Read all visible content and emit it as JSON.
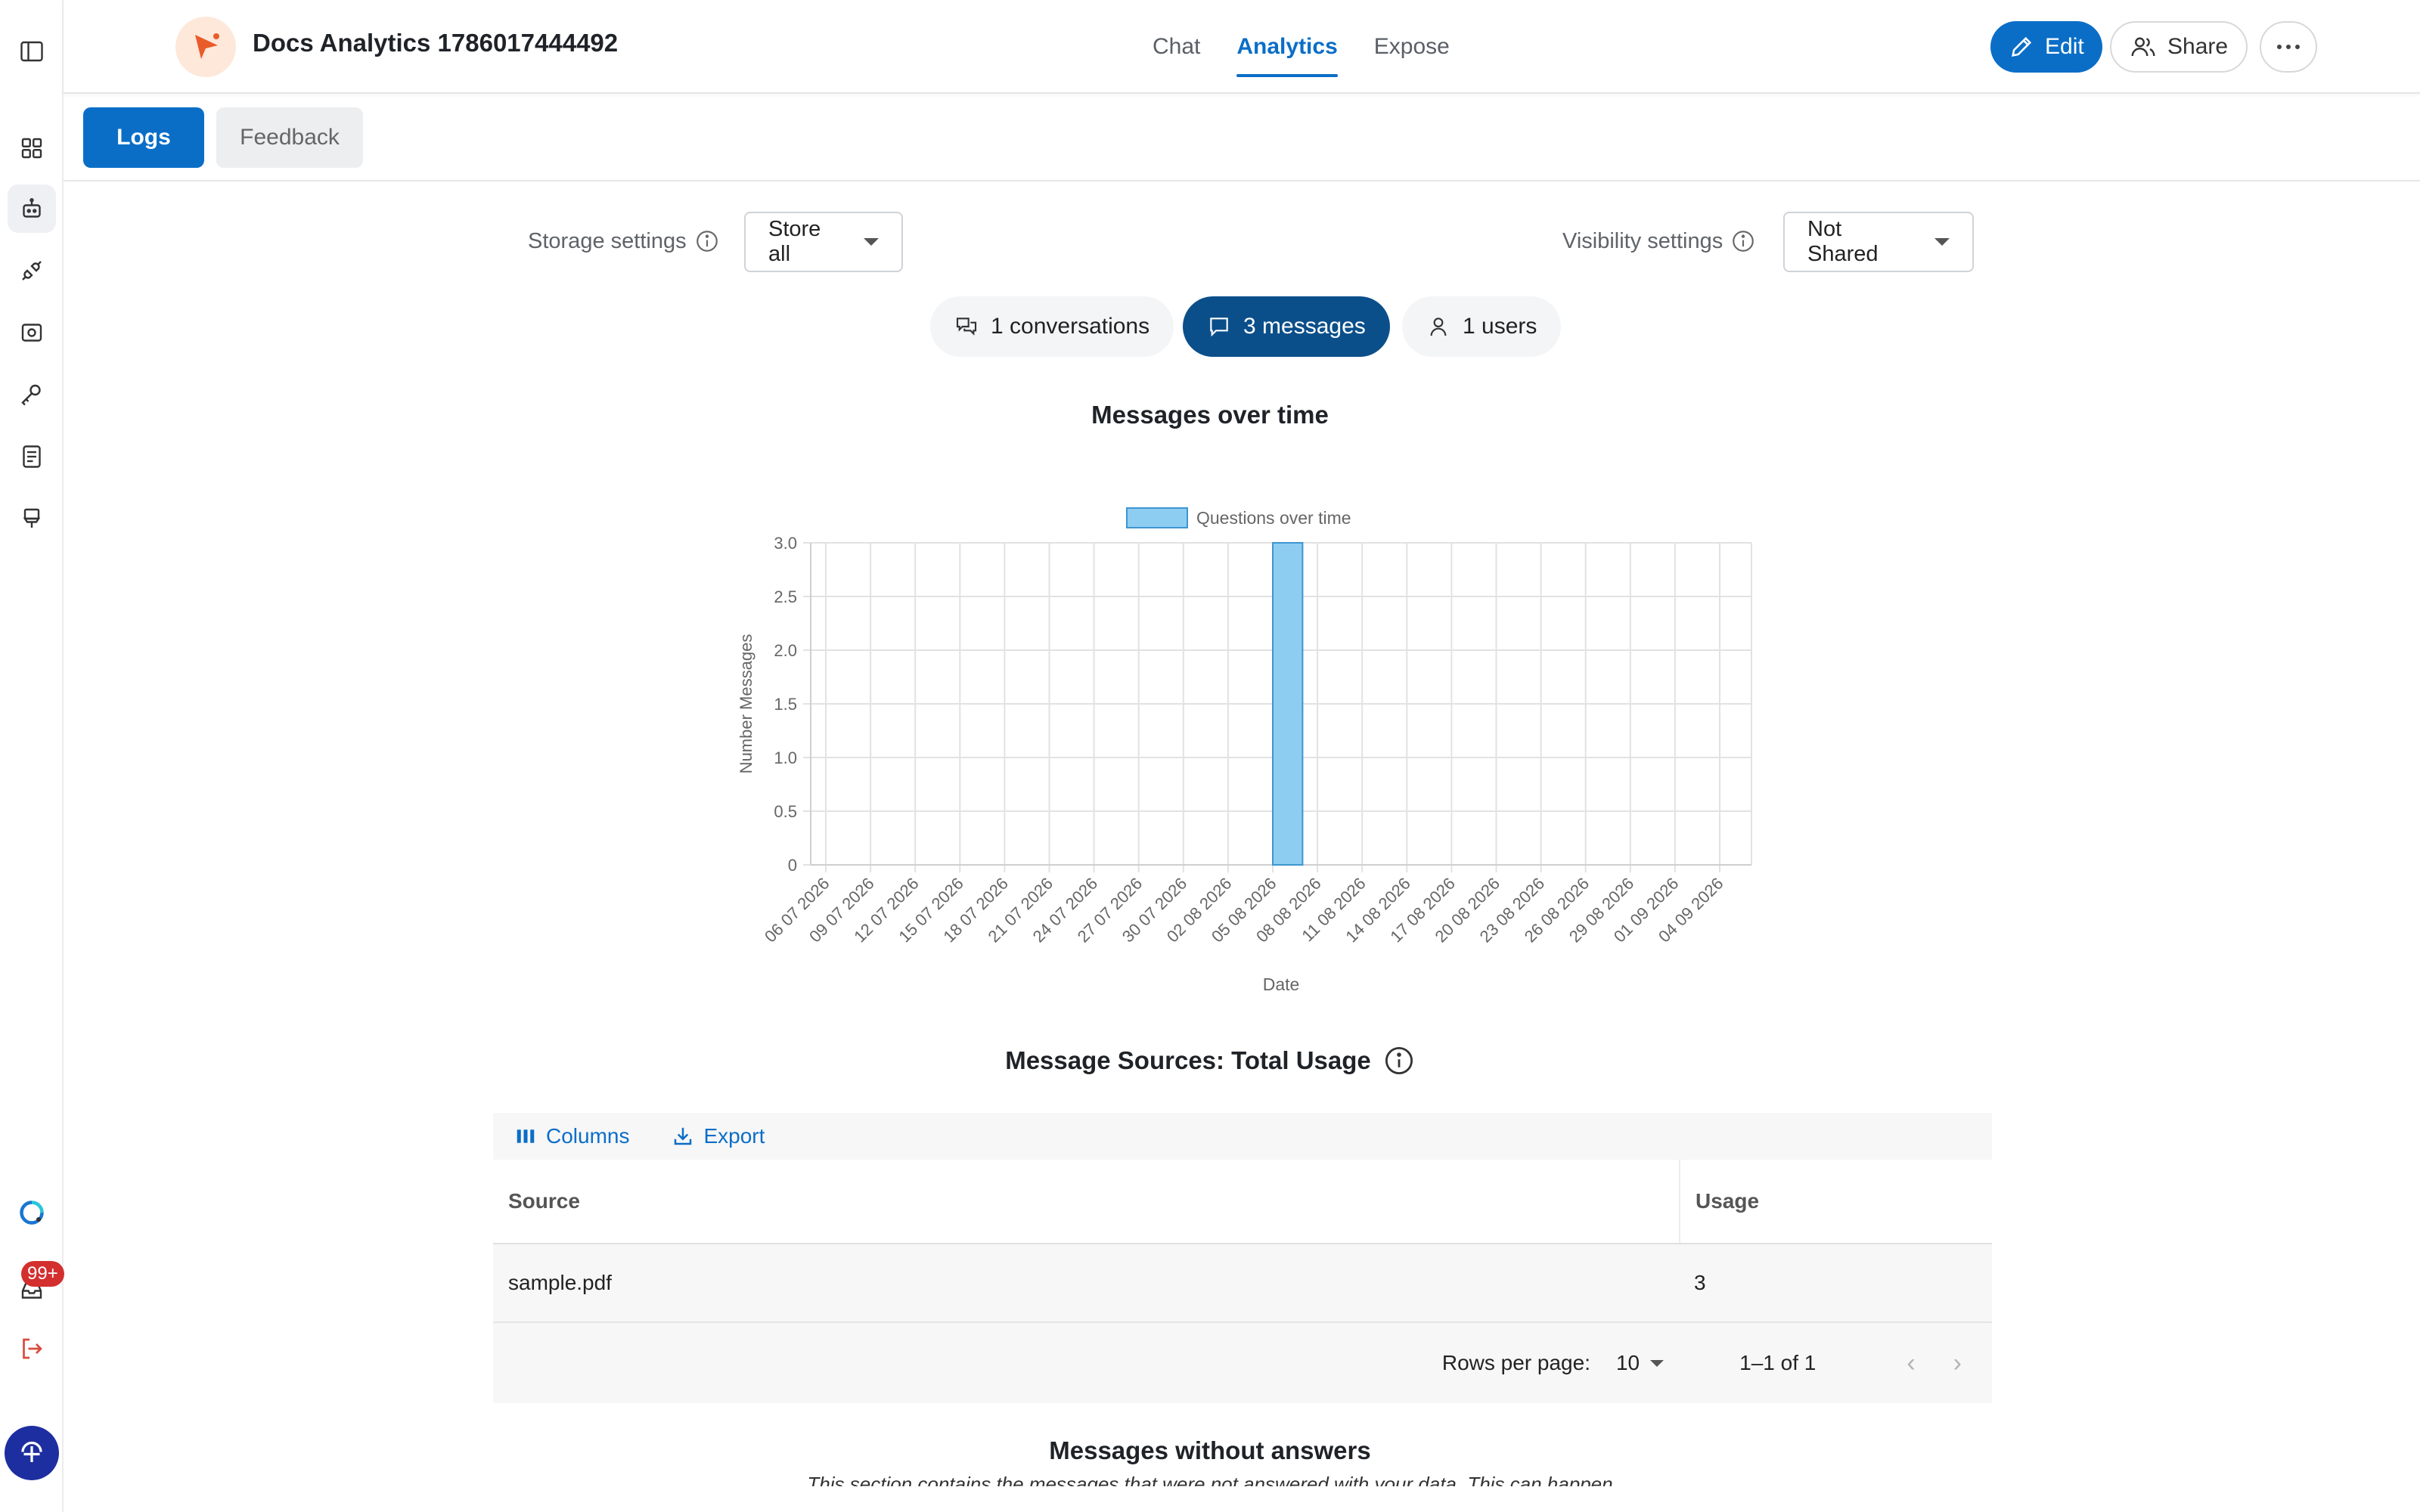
{
  "app": {
    "title": "Docs Analytics 1786017444492",
    "tabs": [
      "Chat",
      "Analytics",
      "Expose"
    ],
    "active_tab": "Analytics",
    "edit_label": "Edit",
    "share_label": "Share"
  },
  "subtabs": {
    "logs": "Logs",
    "feedback": "Feedback"
  },
  "settings": {
    "storage_label": "Storage settings",
    "storage_value": "Store all",
    "visibility_label": "Visibility settings",
    "visibility_value": "Not Shared"
  },
  "stats": {
    "conversations": "1 conversations",
    "messages": "3 messages",
    "users": "1 users"
  },
  "rail": {
    "badge": "99+"
  },
  "chart_title": "Messages over time",
  "chart_data": {
    "type": "bar",
    "legend": "Questions over time",
    "xlabel": "Date",
    "ylabel": "Number Messages",
    "ylim": [
      0,
      3
    ],
    "yticks": [
      "0",
      "0.5",
      "1.0",
      "1.5",
      "2.0",
      "2.5",
      "3.0"
    ],
    "categories": [
      "06 07 2026",
      "09 07 2026",
      "12 07 2026",
      "15 07 2026",
      "18 07 2026",
      "21 07 2026",
      "24 07 2026",
      "27 07 2026",
      "30 07 2026",
      "02 08 2026",
      "05 08 2026",
      "08 08 2026",
      "11 08 2026",
      "14 08 2026",
      "17 08 2026",
      "20 08 2026",
      "23 08 2026",
      "26 08 2026",
      "29 08 2026",
      "01 09 2026",
      "04 09 2026"
    ],
    "series": [
      {
        "name": "Questions over time",
        "x": [
          "06 08 2026"
        ],
        "values": [
          3
        ]
      }
    ],
    "grid": true,
    "legend_position": "top",
    "bar_color": "#8ecdf2"
  },
  "sources": {
    "title": "Message Sources: Total Usage",
    "columns_label": "Columns",
    "export_label": "Export",
    "headers": [
      "Source",
      "Usage"
    ],
    "rows": [
      {
        "source": "sample.pdf",
        "usage": "3"
      }
    ],
    "rows_per_page_label": "Rows per page:",
    "rows_per_page": "10",
    "range": "1–1 of 1"
  },
  "unanswered": {
    "title": "Messages without answers",
    "description": "This section contains the messages that were not answered with your data. This can happen"
  }
}
